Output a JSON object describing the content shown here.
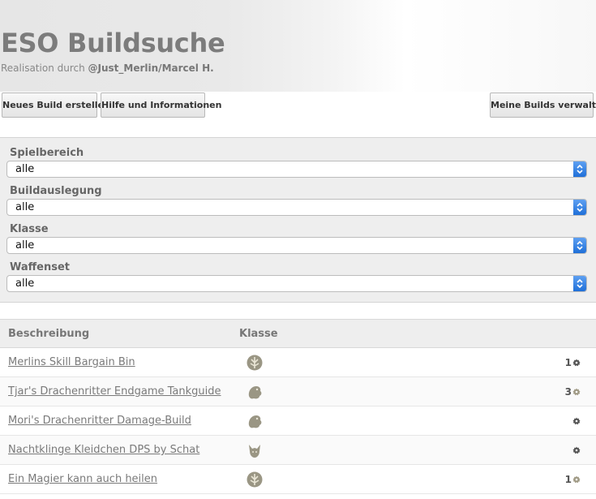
{
  "header": {
    "title": "ESO Buildsuche",
    "credits_prefix": "Realisation durch ",
    "credits_author": "@Just_Merlin/Marcel H."
  },
  "toolbar": {
    "new_build": "Neues Build erstellen",
    "help": "Hilfe und Informationen",
    "my_builds": "Meine Builds verwalten"
  },
  "filters": [
    {
      "label": "Spielbereich",
      "value": "alle"
    },
    {
      "label": "Buildauslegung",
      "value": "alle"
    },
    {
      "label": "Klasse",
      "value": "alle"
    },
    {
      "label": "Waffenset",
      "value": "alle"
    }
  ],
  "table": {
    "headers": {
      "description": "Beschreibung",
      "class": "Klasse"
    },
    "rows": [
      {
        "title": "Merlins Skill Bargain Bin",
        "class_icon": "warden-icon",
        "count": "1",
        "gear_color": "#555555"
      },
      {
        "title": "Tjar's Drachenritter Endgame Tankguide",
        "class_icon": "dragonknight-icon",
        "count": "3",
        "gear_color": "#a09a85"
      },
      {
        "title": "Mori's Drachenritter Damage-Build",
        "class_icon": "dragonknight-icon",
        "count": "",
        "gear_color": "#555555"
      },
      {
        "title": "Nachtklinge Kleidchen DPS by Schat",
        "class_icon": "nightblade-icon",
        "count": "",
        "gear_color": "#555555"
      },
      {
        "title": "Ein Magier kann auch heilen",
        "class_icon": "warden-icon",
        "count": "1",
        "gear_color": "#a09a85"
      }
    ]
  },
  "colors": {
    "accent": "#2f7fe6",
    "icon": "#9a9684",
    "gear_active": "#555555",
    "gear_muted": "#a09a85"
  }
}
